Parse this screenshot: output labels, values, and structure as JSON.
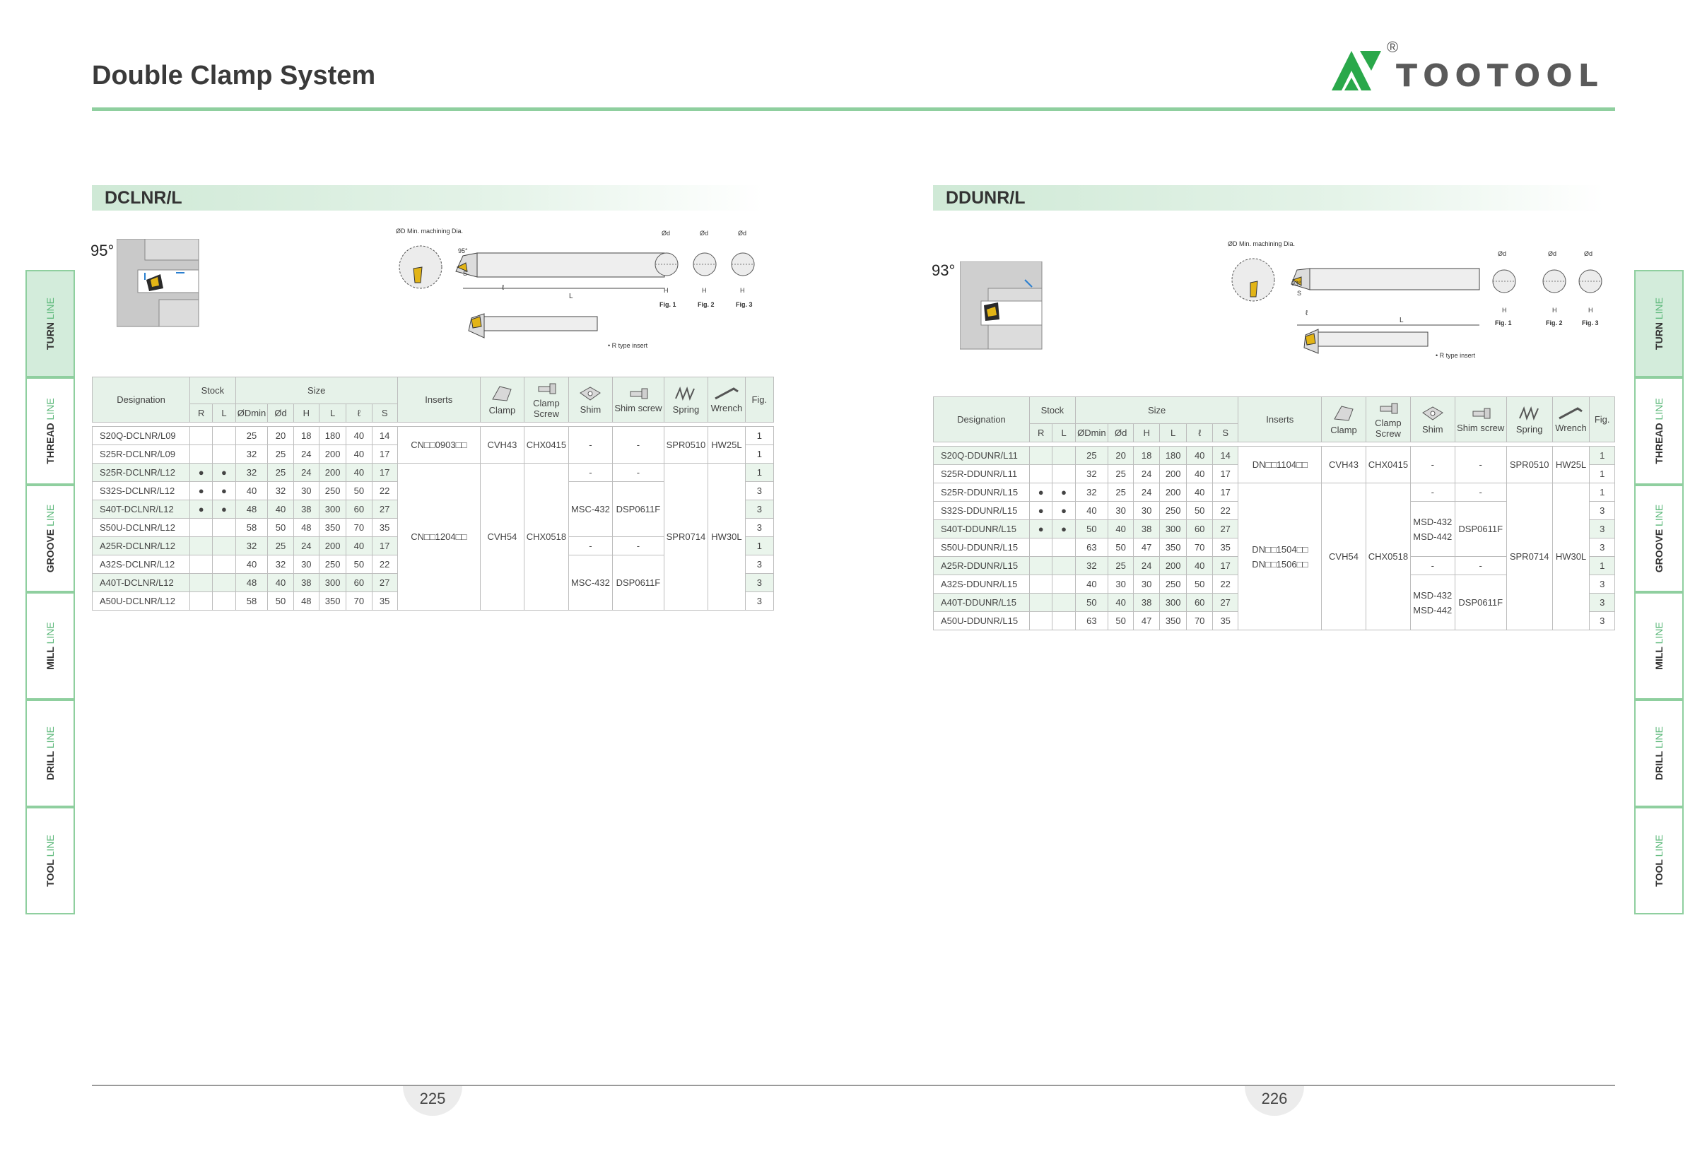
{
  "header": {
    "title": "Double Clamp System",
    "brand": "TOOTOOL",
    "brand_mark": "®"
  },
  "sections": {
    "left": {
      "title": "DCLNR/L",
      "angle": "95°",
      "labels": {
        "min_dia": "ØD Min. machining Dia.",
        "fig1": "Fig. 1",
        "fig2": "Fig. 2",
        "fig3": "Fig. 3",
        "d": "Ød",
        "h": "H",
        "l": "L",
        "l_small": "ℓ",
        "s": "S",
        "deg": "95°",
        "r_type": "• R type insert"
      },
      "columns": {
        "designation": "Designation",
        "stock": "Stock",
        "size": "Size",
        "inserts": "Inserts",
        "clamp": "Clamp",
        "clamp_screw": "Clamp Screw",
        "shim": "Shim",
        "shim_screw": "Shim screw",
        "spring": "Spring",
        "wrench": "Wrench",
        "fig": "Fig.",
        "r": "R",
        "l": "L",
        "dmin": "ØDmin",
        "d": "Ød",
        "h": "H",
        "len": "L",
        "ell": "ℓ",
        "s": "S"
      },
      "rows": [
        {
          "des": "S20Q-DCLNR/L09",
          "r": "",
          "l": "",
          "dmin": "25",
          "d": "20",
          "h": "18",
          "len": "180",
          "ell": "40",
          "s": "14",
          "fig": "1"
        },
        {
          "des": "S25R-DCLNR/L09",
          "r": "",
          "l": "",
          "dmin": "32",
          "d": "25",
          "h": "24",
          "len": "200",
          "ell": "40",
          "s": "17",
          "fig": "1"
        },
        {
          "des": "S25R-DCLNR/L12",
          "r": "●",
          "l": "●",
          "dmin": "32",
          "d": "25",
          "h": "24",
          "len": "200",
          "ell": "40",
          "s": "17",
          "fig": "1"
        },
        {
          "des": "S32S-DCLNR/L12",
          "r": "●",
          "l": "●",
          "dmin": "40",
          "d": "32",
          "h": "30",
          "len": "250",
          "ell": "50",
          "s": "22",
          "fig": "3"
        },
        {
          "des": "S40T-DCLNR/L12",
          "r": "●",
          "l": "●",
          "dmin": "48",
          "d": "40",
          "h": "38",
          "len": "300",
          "ell": "60",
          "s": "27",
          "fig": "3"
        },
        {
          "des": "S50U-DCLNR/L12",
          "r": "",
          "l": "",
          "dmin": "58",
          "d": "50",
          "h": "48",
          "len": "350",
          "ell": "70",
          "s": "35",
          "fig": "3"
        },
        {
          "des": "A25R-DCLNR/L12",
          "r": "",
          "l": "",
          "dmin": "32",
          "d": "25",
          "h": "24",
          "len": "200",
          "ell": "40",
          "s": "17",
          "fig": "1"
        },
        {
          "des": "A32S-DCLNR/L12",
          "r": "",
          "l": "",
          "dmin": "40",
          "d": "32",
          "h": "30",
          "len": "250",
          "ell": "50",
          "s": "22",
          "fig": "3"
        },
        {
          "des": "A40T-DCLNR/L12",
          "r": "",
          "l": "",
          "dmin": "48",
          "d": "40",
          "h": "38",
          "len": "300",
          "ell": "60",
          "s": "27",
          "fig": "3"
        },
        {
          "des": "A50U-DCLNR/L12",
          "r": "",
          "l": "",
          "dmin": "58",
          "d": "50",
          "h": "48",
          "len": "350",
          "ell": "70",
          "s": "35",
          "fig": "3"
        }
      ],
      "groups": {
        "ins1": "CN□□0903□□",
        "ins2": "CN□□1204□□",
        "clamp1": "CVH43",
        "clamp2": "CVH54",
        "cs1": "CHX0415",
        "cs2": "CHX0518",
        "dash": "-",
        "shim_a": "MSC-432",
        "shimscrew_a": "DSP0611F",
        "shim_b": "MSC-432",
        "shimscrew_b": "DSP0611F",
        "spring1": "SPR0510",
        "spring2": "SPR0714",
        "wrench1": "HW25L",
        "wrench2": "HW30L"
      }
    },
    "right": {
      "title": "DDUNR/L",
      "angle": "93°",
      "labels": {
        "min_dia": "ØD Min. machining Dia.",
        "fig1": "Fig. 1",
        "fig2": "Fig. 2",
        "fig3": "Fig. 3",
        "d": "Ød",
        "h": "H",
        "l": "L",
        "l_small": "ℓ",
        "s": "S",
        "deg": "93°",
        "r_type": "• R type insert"
      },
      "columns": {
        "designation": "Designation",
        "stock": "Stock",
        "size": "Size",
        "inserts": "Inserts",
        "clamp": "Clamp",
        "clamp_screw": "Clamp Screw",
        "shim": "Shim",
        "shim_screw": "Shim screw",
        "spring": "Spring",
        "wrench": "Wrench",
        "fig": "Fig.",
        "r": "R",
        "l": "L",
        "dmin": "ØDmin",
        "d": "Ød",
        "h": "H",
        "len": "L",
        "ell": "ℓ",
        "s": "S"
      },
      "rows": [
        {
          "des": "S20Q-DDUNR/L11",
          "r": "",
          "l": "",
          "dmin": "25",
          "d": "20",
          "h": "18",
          "len": "180",
          "ell": "40",
          "s": "14",
          "fig": "1"
        },
        {
          "des": "S25R-DDUNR/L11",
          "r": "",
          "l": "",
          "dmin": "32",
          "d": "25",
          "h": "24",
          "len": "200",
          "ell": "40",
          "s": "17",
          "fig": "1"
        },
        {
          "des": "S25R-DDUNR/L15",
          "r": "●",
          "l": "●",
          "dmin": "32",
          "d": "25",
          "h": "24",
          "len": "200",
          "ell": "40",
          "s": "17",
          "fig": "1"
        },
        {
          "des": "S32S-DDUNR/L15",
          "r": "●",
          "l": "●",
          "dmin": "40",
          "d": "30",
          "h": "30",
          "len": "250",
          "ell": "50",
          "s": "22",
          "fig": "3"
        },
        {
          "des": "S40T-DDUNR/L15",
          "r": "●",
          "l": "●",
          "dmin": "50",
          "d": "40",
          "h": "38",
          "len": "300",
          "ell": "60",
          "s": "27",
          "fig": "3"
        },
        {
          "des": "S50U-DDUNR/L15",
          "r": "",
          "l": "",
          "dmin": "63",
          "d": "50",
          "h": "47",
          "len": "350",
          "ell": "70",
          "s": "35",
          "fig": "3"
        },
        {
          "des": "A25R-DDUNR/L15",
          "r": "",
          "l": "",
          "dmin": "32",
          "d": "25",
          "h": "24",
          "len": "200",
          "ell": "40",
          "s": "17",
          "fig": "1"
        },
        {
          "des": "A32S-DDUNR/L15",
          "r": "",
          "l": "",
          "dmin": "40",
          "d": "30",
          "h": "30",
          "len": "250",
          "ell": "50",
          "s": "22",
          "fig": "3"
        },
        {
          "des": "A40T-DDUNR/L15",
          "r": "",
          "l": "",
          "dmin": "50",
          "d": "40",
          "h": "38",
          "len": "300",
          "ell": "60",
          "s": "27",
          "fig": "3"
        },
        {
          "des": "A50U-DDUNR/L15",
          "r": "",
          "l": "",
          "dmin": "63",
          "d": "50",
          "h": "47",
          "len": "350",
          "ell": "70",
          "s": "35",
          "fig": "3"
        }
      ],
      "groups": {
        "ins1": "DN□□1104□□",
        "ins2a": "DN□□1504□□",
        "ins2b": "DN□□1506□□",
        "clamp1": "CVH43",
        "clamp2": "CVH54",
        "cs1": "CHX0415",
        "cs2": "CHX0518",
        "dash": "-",
        "shim_a1": "MSD-432",
        "shim_a2": "MSD-442",
        "shimscrew_a": "DSP0611F",
        "shim_b1": "MSD-432",
        "shim_b2": "MSD-442",
        "shimscrew_b": "DSP0611F",
        "spring1": "SPR0510",
        "spring2": "SPR0714",
        "wrench1": "HW25L",
        "wrench2": "HW30L"
      }
    }
  },
  "side_tabs": [
    {
      "bold": "TURN",
      "light": "LINE"
    },
    {
      "bold": "THREAD",
      "light": "LINE"
    },
    {
      "bold": "GROOVE",
      "light": "LINE"
    },
    {
      "bold": "MILL",
      "light": "LINE"
    },
    {
      "bold": "DRILL",
      "light": "LINE"
    },
    {
      "bold": "TOOL",
      "light": "LINE"
    }
  ],
  "footer": {
    "page_left": "225",
    "page_right": "226"
  },
  "colors": {
    "accent_green": "#8fcf9f",
    "table_header": "#e6f2e9",
    "row_highlight": "#eaf5ec",
    "insert_gold": "#e2b416"
  }
}
